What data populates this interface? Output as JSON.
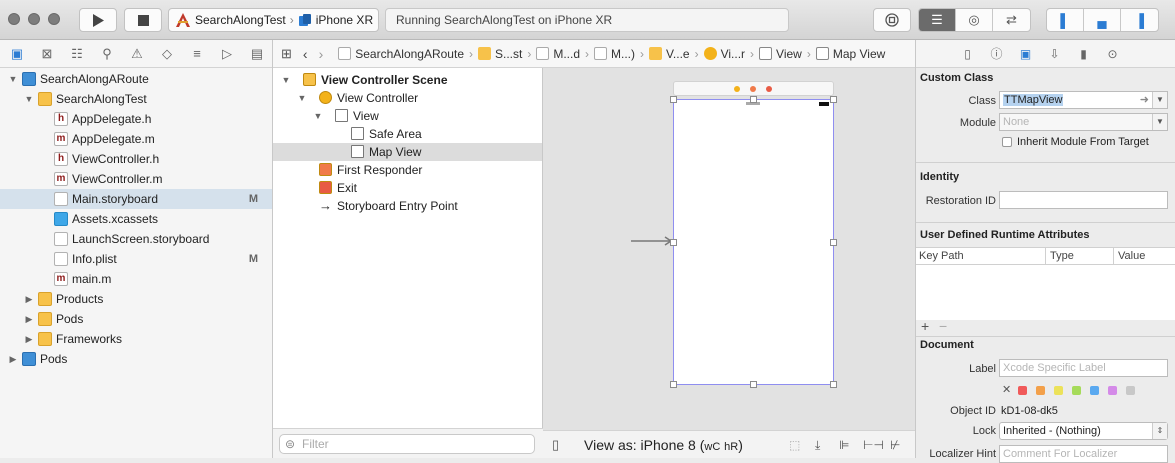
{
  "toolbar": {
    "scheme_target": "SearchAlongTest",
    "scheme_device": "iPhone XR",
    "status": "Running SearchAlongTest on iPhone XR",
    "colors": {
      "selected_segment": "#6b6b6b",
      "accent": "#2b7cd3"
    }
  },
  "navigator": {
    "tree": [
      {
        "label": "SearchAlongARoute",
        "kind": "project",
        "indent": 0,
        "disclosure": "open"
      },
      {
        "label": "SearchAlongTest",
        "kind": "folder",
        "indent": 1,
        "disclosure": "open"
      },
      {
        "label": "AppDelegate.h",
        "kind": "h",
        "indent": 2,
        "badge": "h"
      },
      {
        "label": "AppDelegate.m",
        "kind": "m",
        "indent": 2,
        "badge": "m"
      },
      {
        "label": "ViewController.h",
        "kind": "h",
        "indent": 2,
        "badge": "h"
      },
      {
        "label": "ViewController.m",
        "kind": "m",
        "indent": 2,
        "badge": "m"
      },
      {
        "label": "Main.storyboard",
        "kind": "storyboard",
        "indent": 2,
        "status": "M",
        "selected": true
      },
      {
        "label": "Assets.xcassets",
        "kind": "assets",
        "indent": 2
      },
      {
        "label": "LaunchScreen.storyboard",
        "kind": "storyboard",
        "indent": 2
      },
      {
        "label": "Info.plist",
        "kind": "plist",
        "indent": 2,
        "status": "M"
      },
      {
        "label": "main.m",
        "kind": "m",
        "indent": 2,
        "badge": "m"
      },
      {
        "label": "Products",
        "kind": "folder",
        "indent": 1,
        "disclosure": "closed"
      },
      {
        "label": "Pods",
        "kind": "folder",
        "indent": 1,
        "disclosure": "closed"
      },
      {
        "label": "Frameworks",
        "kind": "folder",
        "indent": 1,
        "disclosure": "closed"
      },
      {
        "label": "Pods",
        "kind": "project",
        "indent": 0,
        "disclosure": "closed"
      }
    ]
  },
  "jumpbar": {
    "crumbs": [
      "SearchAlongARoute",
      "S...st",
      "M...d",
      "M...)",
      "V...e",
      "Vi...r",
      "View",
      "Map View"
    ]
  },
  "outline": {
    "items": [
      {
        "label": "View Controller Scene",
        "indent": 0,
        "disclosure": "open",
        "icon": "scene",
        "bold": true
      },
      {
        "label": "View Controller",
        "indent": 1,
        "disclosure": "open",
        "icon": "vc"
      },
      {
        "label": "View",
        "indent": 2,
        "disclosure": "open",
        "icon": "view"
      },
      {
        "label": "Safe Area",
        "indent": 3,
        "icon": "safearea"
      },
      {
        "label": "Map View",
        "indent": 3,
        "icon": "view",
        "selected": true
      },
      {
        "label": "First Responder",
        "indent": 1,
        "icon": "responder"
      },
      {
        "label": "Exit",
        "indent": 1,
        "icon": "exit"
      },
      {
        "label": "Storyboard Entry Point",
        "indent": 1,
        "icon": "arrow"
      }
    ],
    "filter_placeholder": "Filter"
  },
  "canvas": {
    "view_as_prefix": "View as: iPhone 8 (",
    "w_label": "wC",
    "h_label": "hR",
    "view_as_suffix": ")"
  },
  "inspector": {
    "custom_class_title": "Custom Class",
    "class_label": "Class",
    "class_value": "TTMapView",
    "module_label": "Module",
    "module_placeholder": "None",
    "inherit_label": "Inherit Module From Target",
    "identity_title": "Identity",
    "restoration_label": "Restoration ID",
    "udra_title": "User Defined Runtime Attributes",
    "col_key": "Key Path",
    "col_type": "Type",
    "col_value": "Value",
    "document_title": "Document",
    "label_label": "Label",
    "label_placeholder": "Xcode Specific Label",
    "swatches": [
      "#f05a5a",
      "#f3a04a",
      "#ece25a",
      "#a6db5a",
      "#5aa9f0",
      "#d48ae8",
      "#c8c8c8"
    ],
    "object_id_label": "Object ID",
    "object_id_value": "kD1-08-dk5",
    "lock_label": "Lock",
    "lock_value": "Inherited - (Nothing)",
    "localizer_label": "Localizer Hint",
    "localizer_placeholder": "Comment For Localizer"
  }
}
